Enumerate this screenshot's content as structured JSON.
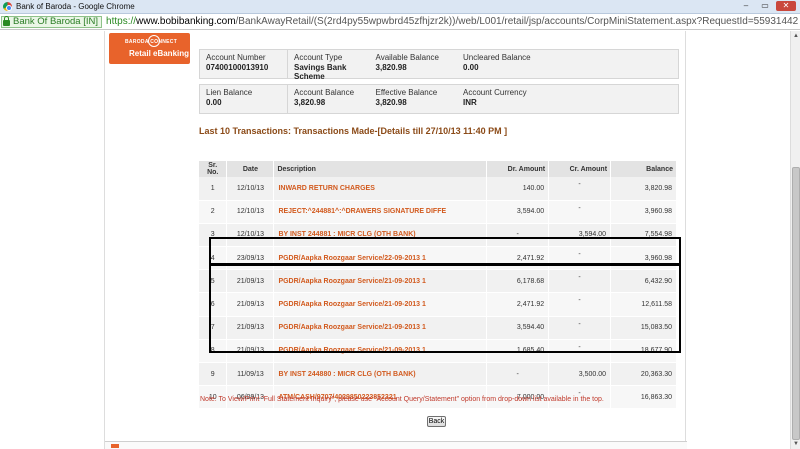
{
  "window": {
    "title": "Bank of Baroda - Google Chrome",
    "buttons": {
      "minimize": "–",
      "maximize": "▭",
      "close": "✕"
    }
  },
  "address": {
    "site_identity": "Bank Of Baroda [IN]",
    "scheme": "https://",
    "host": "www.bobibanking.com",
    "path": "/BankAwayRetail/(S(2rd4py55wpwbrd45zfhjzr2k))/web/L001/retail/jsp/accounts/CorpMiniStatement.aspx?RequestId=55931442"
  },
  "logo": {
    "line1": "BARODA CONNECT",
    "line2": "Retail eBanking"
  },
  "summary_row1": [
    {
      "label": "Account Number",
      "value": "07400100013910"
    },
    {
      "label": "Account Type",
      "value": "Savings Bank Scheme"
    },
    {
      "label": "Available Balance",
      "value": "3,820.98"
    },
    {
      "label": "Uncleared Balance",
      "value": "0.00"
    }
  ],
  "summary_row2": [
    {
      "label": "Lien Balance",
      "value": "0.00"
    },
    {
      "label": "Account Balance",
      "value": "3,820.98"
    },
    {
      "label": "Effective Balance",
      "value": "3,820.98"
    },
    {
      "label": "Account Currency",
      "value": "INR"
    }
  ],
  "heading": "Last 10 Transactions: Transactions Made-[Details till 27/10/13 11:40 PM ]",
  "table": {
    "headers": [
      "Sr. No.",
      "Date",
      "Description",
      "Dr. Amount",
      "Cr. Amount",
      "Balance"
    ],
    "rows": [
      {
        "sr": "1",
        "date": "12/10/13",
        "desc": "INWARD RETURN CHARGES",
        "dr": "140.00",
        "cr": "-",
        "bal": "3,820.98"
      },
      {
        "sr": "2",
        "date": "12/10/13",
        "desc": "REJECT:^244881^:^DRAWERS SIGNATURE DIFFE",
        "dr": "3,594.00",
        "cr": "-",
        "bal": "3,960.98"
      },
      {
        "sr": "3",
        "date": "12/10/13",
        "desc": "BY INST 244881 : MICR CLG (OTH BANK)",
        "dr": "-",
        "cr": "3,594.00",
        "bal": "7,554.98"
      },
      {
        "sr": "4",
        "date": "23/09/13",
        "desc": "PGDR/Aapka Roozgaar Service/22-09-2013 1",
        "dr": "2,471.92",
        "cr": "-",
        "bal": "3,960.98"
      },
      {
        "sr": "5",
        "date": "21/09/13",
        "desc": "PGDR/Aapka Roozgaar Service/21-09-2013 1",
        "dr": "6,178.68",
        "cr": "-",
        "bal": "6,432.90"
      },
      {
        "sr": "6",
        "date": "21/09/13",
        "desc": "PGDR/Aapka Roozgaar Service/21-09-2013 1",
        "dr": "2,471.92",
        "cr": "-",
        "bal": "12,611.58"
      },
      {
        "sr": "7",
        "date": "21/09/13",
        "desc": "PGDR/Aapka Roozgaar Service/21-09-2013 1",
        "dr": "3,594.40",
        "cr": "-",
        "bal": "15,083.50"
      },
      {
        "sr": "8",
        "date": "21/09/13",
        "desc": "PGDR/Aapka Roozgaar Service/21-09-2013 1",
        "dr": "1,685.40",
        "cr": "-",
        "bal": "18,677.90"
      },
      {
        "sr": "9",
        "date": "11/09/13",
        "desc": "BY INST 244880 : MICR CLG (OTH BANK)",
        "dr": "-",
        "cr": "3,500.00",
        "bal": "20,363.30"
      },
      {
        "sr": "10",
        "date": "06/09/13",
        "desc": "ATM/CASH/9707/4029850223852321",
        "dr": "7,000.00",
        "cr": "-",
        "bal": "16,863.30"
      }
    ]
  },
  "note": "Note: To View/Print \"Full Statement Inquiry\", please use \"Account Query/Statement\" option from drop-down list available in the top.",
  "back_label": "Back",
  "colors": {
    "accent": "#e8632b",
    "heading": "#8b4a17",
    "link": "#d25a1e"
  }
}
